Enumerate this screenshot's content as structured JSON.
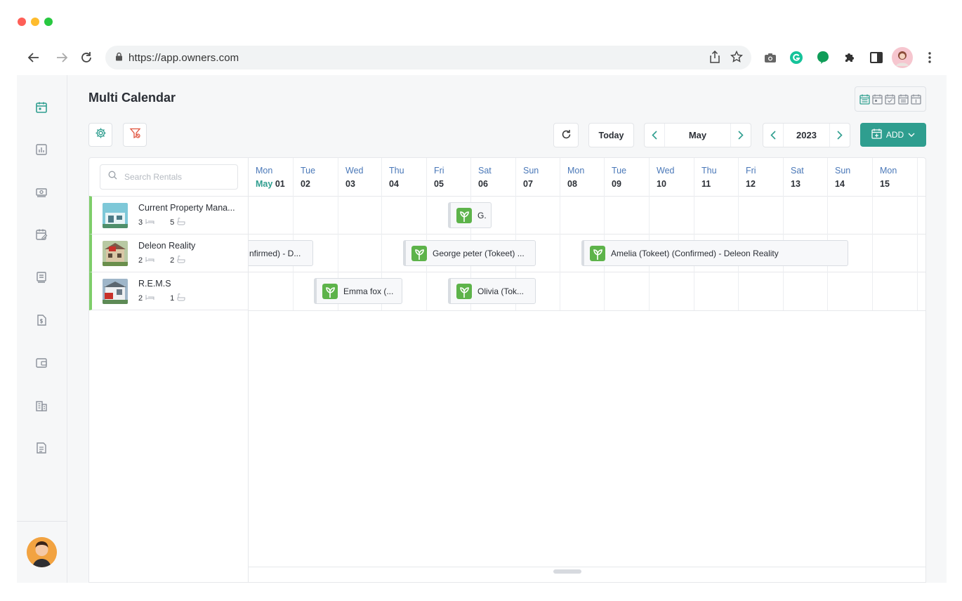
{
  "browser": {
    "url": "https://app.owners.com"
  },
  "page": {
    "title": "Multi Calendar"
  },
  "controls": {
    "today_label": "Today",
    "month": "May",
    "year": "2023",
    "add_label": "ADD"
  },
  "search": {
    "placeholder": "Search Rentals"
  },
  "rentals": [
    {
      "name": "Current Property Mana...",
      "bedrooms": "3",
      "bathrooms": "5"
    },
    {
      "name": "Deleon Reality",
      "bedrooms": "2",
      "bathrooms": "2"
    },
    {
      "name": "R.E.M.S",
      "bedrooms": "2",
      "bathrooms": "1"
    }
  ],
  "days": [
    {
      "name": "Mon",
      "month": "May",
      "date": "01"
    },
    {
      "name": "Tue",
      "date": "02"
    },
    {
      "name": "Wed",
      "date": "03"
    },
    {
      "name": "Thu",
      "date": "04"
    },
    {
      "name": "Fri",
      "date": "05"
    },
    {
      "name": "Sat",
      "date": "06"
    },
    {
      "name": "Sun",
      "date": "07"
    },
    {
      "name": "Mon",
      "date": "08"
    },
    {
      "name": "Tue",
      "date": "09"
    },
    {
      "name": "Wed",
      "date": "10"
    },
    {
      "name": "Thu",
      "date": "11"
    },
    {
      "name": "Fri",
      "date": "12"
    },
    {
      "name": "Sat",
      "date": "13"
    },
    {
      "name": "Sun",
      "date": "14"
    },
    {
      "name": "Mon",
      "date": "15"
    }
  ],
  "bookings": [
    {
      "label": "G.",
      "rental": 0
    },
    {
      "label": "nfirmed) - D...",
      "rental": 1
    },
    {
      "label": "George peter (Tokeet) ...",
      "rental": 1
    },
    {
      "label": "Amelia (Tokeet) (Confirmed) - Deleon Reality",
      "rental": 1
    },
    {
      "label": "Emma fox (...",
      "rental": 2
    },
    {
      "label": "Olivia (Tok...",
      "rental": 2
    }
  ],
  "colors": {
    "accent": "#2f9e8f",
    "rental_bar": "#7fce6a",
    "filter_icon": "#e0533d",
    "weekday": "#4a78b8"
  }
}
